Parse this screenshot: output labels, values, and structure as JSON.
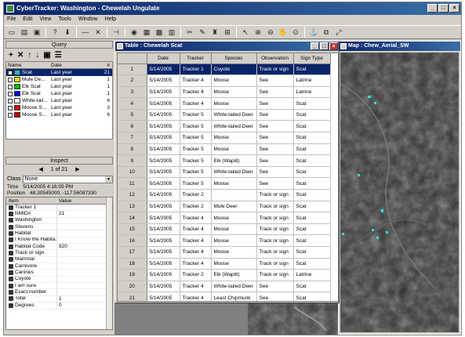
{
  "app": {
    "title": "CyberTracker: Washington - Chewelah Ungulate",
    "window_buttons": [
      "_",
      "□",
      "×"
    ]
  },
  "menu": [
    "File",
    "Edit",
    "View",
    "Tools",
    "Window",
    "Help"
  ],
  "toolbar_icons": [
    "new-icon",
    "open-icon",
    "save-icon",
    "help-icon",
    "download-icon",
    "remove-icon",
    "delete-icon",
    "arrow-icon",
    "globe-icon",
    "table-icon",
    "map-icon",
    "chart-icon",
    "tools-icon",
    "filter-icon",
    "select-icon",
    "zoom-in-icon",
    "zoom-out-icon",
    "pan-icon",
    "zoom-extent-icon"
  ],
  "query": {
    "header": "Query",
    "columns": {
      "name": "Name",
      "date": "Date",
      "count": "#"
    },
    "rows": [
      {
        "name": "Scat",
        "date": "Last year",
        "count": "21",
        "color": "#20c0c0",
        "selected": true
      },
      {
        "name": "Mule De...",
        "date": "Last year",
        "count": "1",
        "color": "#e0e000"
      },
      {
        "name": "Elk Scat",
        "date": "Last year",
        "count": "1",
        "color": "#00c000"
      },
      {
        "name": "Elk Scat",
        "date": "Last year",
        "count": "1",
        "color": "#0000e0"
      },
      {
        "name": "White-tail...",
        "date": "Last year",
        "count": "6",
        "color": "#ffffff"
      },
      {
        "name": "Moose S...",
        "date": "Last year",
        "count": "3",
        "color": "#e00000"
      },
      {
        "name": "Moose S...",
        "date": "Last year",
        "count": "6",
        "color": "#c00000"
      }
    ]
  },
  "inspect": {
    "header": "Inspect",
    "counter": "1 of 21",
    "class_label": "Class",
    "class_value": "None",
    "time_label": "Time",
    "time_value": "5/14/2005 4:16:05 PM",
    "position_label": "Position",
    "position_value": "48.30545000, -117.56087330",
    "columns": {
      "item": "Item",
      "value": "Value"
    },
    "rows": [
      {
        "item": "Tracker 1",
        "value": ""
      },
      {
        "item": "NMID#",
        "value": "21"
      },
      {
        "item": "Washington",
        "value": ""
      },
      {
        "item": "Stevens",
        "value": ""
      },
      {
        "item": "Habitat",
        "value": ""
      },
      {
        "item": "I Know the Habita...",
        "value": ""
      },
      {
        "item": "Habitat Code",
        "value": "920"
      },
      {
        "item": "Track or sign",
        "value": ""
      },
      {
        "item": "Mammal",
        "value": ""
      },
      {
        "item": "Carnivore",
        "value": ""
      },
      {
        "item": "Canines",
        "value": ""
      },
      {
        "item": "Coyote",
        "value": ""
      },
      {
        "item": "I am sure",
        "value": ""
      },
      {
        "item": "Exact number",
        "value": ""
      },
      {
        "item": "Total",
        "value": "1"
      },
      {
        "item": "Degrees",
        "value": "0"
      }
    ]
  },
  "table_window": {
    "title": "Table : Chewelah Scat",
    "columns": [
      "Date",
      "Tracker",
      "Species",
      "Observation",
      "Sign Type"
    ],
    "rows": [
      [
        "1",
        "5/14/2005",
        "Tracker 1",
        "Coyote",
        "Track or sign",
        "Scat"
      ],
      [
        "2",
        "5/14/2005",
        "Tracker 4",
        "Moose",
        "See",
        "Latrine"
      ],
      [
        "3",
        "5/14/2005",
        "Tracker 4",
        "Moose",
        "See",
        "Latrine"
      ],
      [
        "4",
        "5/14/2005",
        "Tracker 4",
        "Moose",
        "See",
        "Scat"
      ],
      [
        "5",
        "5/14/2005",
        "Tracker 5",
        "White-tailed Deer",
        "See",
        "Scat"
      ],
      [
        "6",
        "5/14/2005",
        "Tracker 5",
        "White-tailed Deer",
        "See",
        "Scat"
      ],
      [
        "7",
        "5/14/2005",
        "Tracker 5",
        "Moose",
        "See",
        "Scat"
      ],
      [
        "8",
        "5/14/2005",
        "Tracker 5",
        "Moose",
        "See",
        "Scat"
      ],
      [
        "9",
        "5/14/2005",
        "Tracker 5",
        "Elk (Wapiti)",
        "See",
        "Scat"
      ],
      [
        "10",
        "5/14/2005",
        "Tracker 5",
        "White-tailed Deer",
        "See",
        "Scat"
      ],
      [
        "11",
        "5/14/2005",
        "Tracker 5",
        "Moose",
        "See",
        "Scat"
      ],
      [
        "12",
        "5/14/2005",
        "Tracker 2",
        "",
        "Track or sign",
        "Scat"
      ],
      [
        "13",
        "5/14/2005",
        "Tracker 2",
        "Mule Deer",
        "Track or sign",
        "Scat"
      ],
      [
        "14",
        "5/14/2005",
        "Tracker 4",
        "Moose",
        "Track or sign",
        "Scat"
      ],
      [
        "15",
        "5/14/2005",
        "Tracker 4",
        "Moose",
        "Track or sign",
        "Scat"
      ],
      [
        "16",
        "5/14/2005",
        "Tracker 4",
        "Moose",
        "Track or sign",
        "Scat"
      ],
      [
        "17",
        "5/14/2005",
        "Tracker 4",
        "Moose",
        "Track or sign",
        "Scat"
      ],
      [
        "18",
        "5/14/2005",
        "Tracker 4",
        "Moose",
        "Track or sign",
        "Scat"
      ],
      [
        "19",
        "5/14/2005",
        "Tracker 2",
        "Elk (Wapiti)",
        "Track or sign",
        "Latrine"
      ],
      [
        "20",
        "5/14/2005",
        "Tracker 4",
        "White-tailed Deer",
        "See",
        "Scat"
      ],
      [
        "21",
        "5/14/2005",
        "Tracker 4",
        "Least Chipmunk",
        "See",
        "Scat"
      ]
    ]
  },
  "map_window": {
    "title": "Map : Chew_Aerial_SW"
  }
}
